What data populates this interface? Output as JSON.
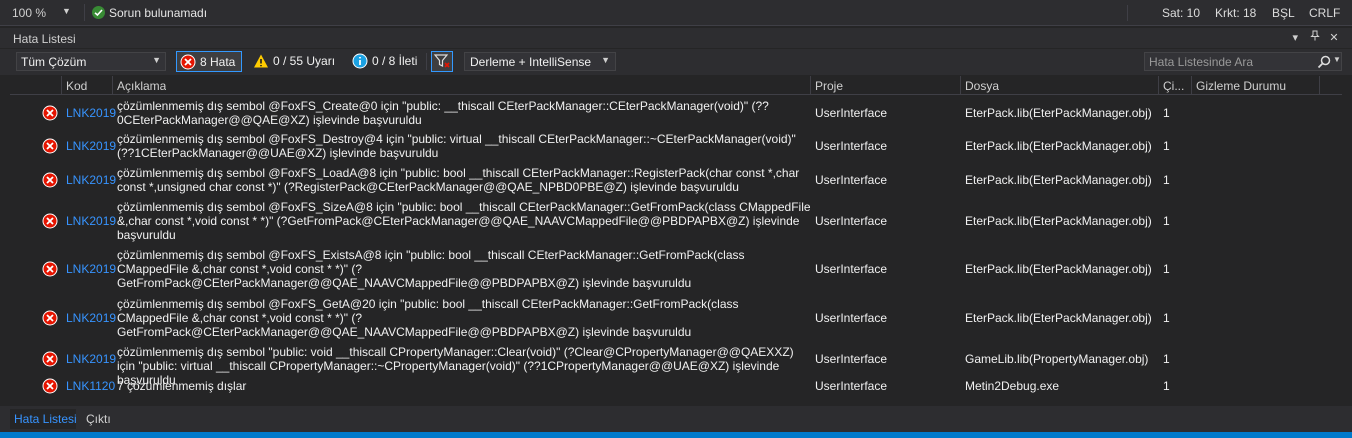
{
  "status_strip": {
    "zoom": "100 %",
    "status_message": "Sorun bulunamadı",
    "line": "Sat: 10",
    "column": "Krkt: 18",
    "insert_mode": "BŞL",
    "line_ending": "CRLF"
  },
  "panel": {
    "title": "Hata Listesi"
  },
  "toolbar": {
    "scope": "Tüm Çözüm",
    "errors_label": "8 Hata",
    "warnings_label": "0 / 55 Uyarı",
    "messages_label": "0 / 8 İleti",
    "build_filter": "Derleme + IntelliSense",
    "search_placeholder": "Hata Listesinde Ara"
  },
  "columns": {
    "code": "Kod",
    "description": "Açıklama",
    "project": "Proje",
    "file": "Dosya",
    "line": "Çi...",
    "suppression": "Gizleme Durumu"
  },
  "errors": [
    {
      "code": "LNK2019",
      "description": "çözümlenmemiş dış sembol @FoxFS_Create@0 için \"public: __thiscall CEterPackManager::CEterPackManager(void)\" (??0CEterPackManager@@QAE@XZ) işlevinde başvuruldu",
      "project": "UserInterface",
      "file": "EterPack.lib(EterPackManager.obj)",
      "line": "1"
    },
    {
      "code": "LNK2019",
      "description": "çözümlenmemiş dış sembol @FoxFS_Destroy@4 için \"public: virtual __thiscall CEterPackManager::~CEterPackManager(void)\" (??1CEterPackManager@@UAE@XZ) işlevinde başvuruldu",
      "project": "UserInterface",
      "file": "EterPack.lib(EterPackManager.obj)",
      "line": "1"
    },
    {
      "code": "LNK2019",
      "description": "çözümlenmemiş dış sembol @FoxFS_LoadA@8 için \"public: bool __thiscall CEterPackManager::RegisterPack(char const *,char const *,unsigned char const *)\" (?RegisterPack@CEterPackManager@@QAE_NPBD0PBE@Z) işlevinde başvuruldu",
      "project": "UserInterface",
      "file": "EterPack.lib(EterPackManager.obj)",
      "line": "1"
    },
    {
      "code": "LNK2019",
      "description": "çözümlenmemiş dış sembol @FoxFS_SizeA@8 için \"public: bool __thiscall CEterPackManager::GetFromPack(class CMappedFile &,char const *,void const * *)\" (?GetFromPack@CEterPackManager@@QAE_NAAVCMappedFile@@PBDPAPBX@Z) işlevinde başvuruldu",
      "project": "UserInterface",
      "file": "EterPack.lib(EterPackManager.obj)",
      "line": "1"
    },
    {
      "code": "LNK2019",
      "description": "çözümlenmemiş dış sembol @FoxFS_ExistsA@8 için \"public: bool __thiscall CEterPackManager::GetFromPack(class CMappedFile &,char const *,void const * *)\" (?GetFromPack@CEterPackManager@@QAE_NAAVCMappedFile@@PBDPAPBX@Z) işlevinde başvuruldu",
      "project": "UserInterface",
      "file": "EterPack.lib(EterPackManager.obj)",
      "line": "1"
    },
    {
      "code": "LNK2019",
      "description": "çözümlenmemiş dış sembol @FoxFS_GetA@20 için \"public: bool __thiscall CEterPackManager::GetFromPack(class CMappedFile &,char const *,void const * *)\" (?GetFromPack@CEterPackManager@@QAE_NAAVCMappedFile@@PBDPAPBX@Z) işlevinde başvuruldu",
      "project": "UserInterface",
      "file": "EterPack.lib(EterPackManager.obj)",
      "line": "1"
    },
    {
      "code": "LNK2019",
      "description": "çözümlenmemiş dış sembol \"public: void __thiscall CPropertyManager::Clear(void)\" (?Clear@CPropertyManager@@QAEXXZ) için \"public: virtual __thiscall CPropertyManager::~CPropertyManager(void)\" (??1CPropertyManager@@UAE@XZ) işlevinde başvuruldu",
      "project": "UserInterface",
      "file": "GameLib.lib(PropertyManager.obj)",
      "line": "1"
    },
    {
      "code": "LNK1120",
      "description": "7 çözümlenmemiş dışlar",
      "project": "UserInterface",
      "file": "Metin2Debug.exe",
      "line": "1"
    }
  ],
  "bottom_tabs": {
    "errors_tab": "Hata Listesi",
    "output_tab": "Çıktı"
  },
  "colors": {
    "background": "#252526",
    "chrome": "#2d2d30",
    "accent": "#007acc",
    "link": "#3794ff",
    "error": "#e51400",
    "success": "#388a34",
    "warning": "#ffcc00",
    "info": "#1ba1e2"
  }
}
